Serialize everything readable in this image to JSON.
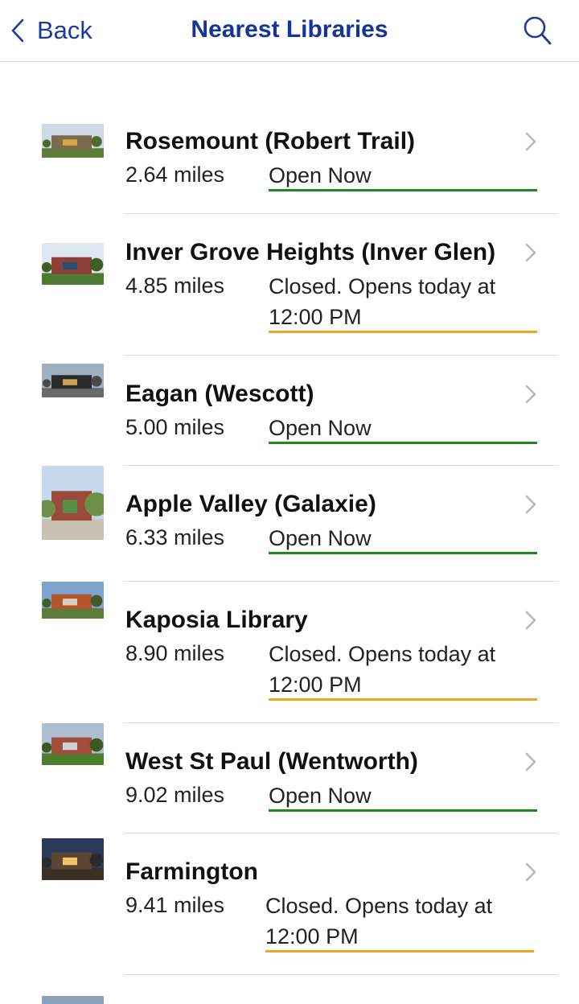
{
  "nav": {
    "back_label": "Back",
    "title": "Nearest Libraries"
  },
  "colors": {
    "accent": "#1f3b99",
    "open": "#1e8a1e",
    "closed": "#f0a81e"
  },
  "libraries": [
    {
      "name": "Rosemount (Robert Trail)",
      "distance": "2.64 miles",
      "status": "Open Now",
      "state": "open"
    },
    {
      "name": "Inver Grove Heights (Inver Glen)",
      "distance": "4.85 miles",
      "status": "Closed. Opens today at 12:00 PM",
      "state": "closed"
    },
    {
      "name": "Eagan (Wescott)",
      "distance": "5.00 miles",
      "status": "Open Now",
      "state": "open"
    },
    {
      "name": "Apple Valley (Galaxie)",
      "distance": "6.33 miles",
      "status": "Open Now",
      "state": "open"
    },
    {
      "name": "Kaposia Library",
      "distance": "8.90 miles",
      "status": "Closed. Opens today at 12:00 PM",
      "state": "closed"
    },
    {
      "name": "West St Paul (Wentworth)",
      "distance": "9.02 miles",
      "status": "Open Now",
      "state": "open"
    },
    {
      "name": "Farmington",
      "distance": "9.41 miles",
      "status": "Closed. Opens today at 12:00 PM",
      "state": "closed"
    }
  ]
}
